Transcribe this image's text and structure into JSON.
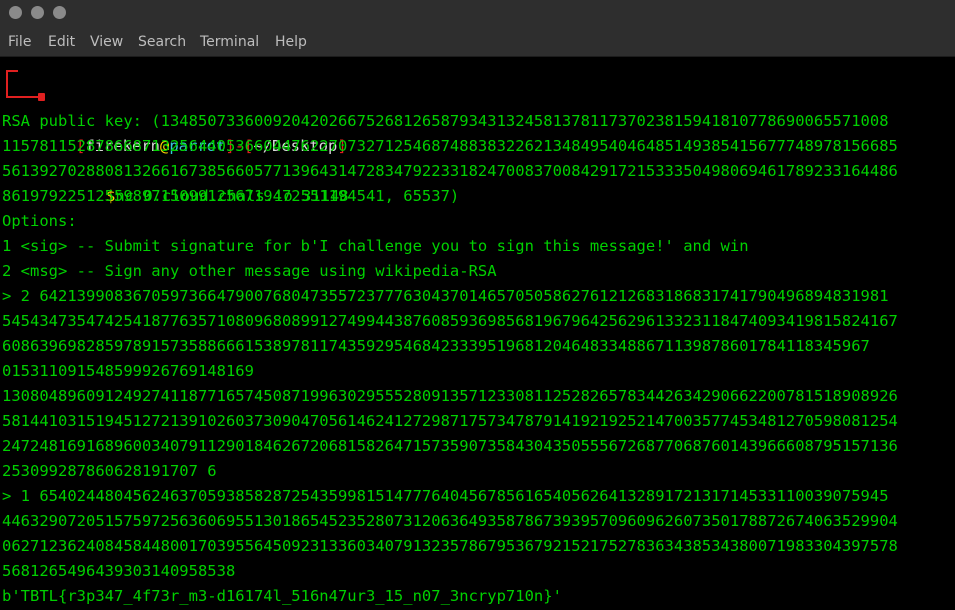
{
  "menubar": {
    "items": [
      "File",
      "Edit",
      "View",
      "Search",
      "Terminal",
      "Help"
    ]
  },
  "prompt": {
    "bracket_open": "[",
    "user": "firekern",
    "at": "@",
    "host": "parrot",
    "bracket_close": "]",
    "sep": "-[",
    "cwd": "~/Desktop",
    "cwd_close": "]",
    "dollar": "$",
    "command": "nc 0.cloud.chals.io 31148"
  },
  "output": [
    "RSA public key: (134850733600920420266752681265879343132458137811737023815941810778690065571008",
    "115781152878668713256440536604476227073271254687488383226213484954046485149385415677748978156685",
    "561392702880813266167385660577139643147283479223318247008370084291721533350498069461789233164486",
    "86197922512559897150991256719472551194541, 65537)",
    "Options:",
    "1 <sig> -- Submit signature for b'I challenge you to sign this message!' and win",
    "2 <msg> -- Sign any other message using wikipedia-RSA",
    "> 2 6421399083670597366479007680473557237776304370146570505862761212683186831741790496894831981",
    "545434735474254187763571080968089912749944387608593698568196796425629613323118474093419815824167",
    "608639698285978915735886661538978117435929546842333951968120464833488671139878601784118345967",
    "015311091548599926769148169",
    "130804896091249274118771657450871996302955528091357123308112528265783442634290662200781518908926",
    "581441031519451272139102603730904705614624127298717573478791419219252147003577453481270598081254",
    "247248169168960034079112901846267206815826471573590735843043505556726877068760143966608795157136",
    "253099287860628191707 6",
    "> 1 6540244804562463705938582872543599815147776404567856165405626413289172131714533110039075945",
    "446329072051575972563606955130186545235280731206364935878673939570960962607350178872674063529904",
    "062712362408458448001703955645092313360340791323578679536792152175278363438534380071983304397578",
    "5681265496439303140958538",
    "b'TBTL{r3p347_4f73r_m3-d16174l_516n47ur3_15_n07_3ncryp710n}'"
  ]
}
